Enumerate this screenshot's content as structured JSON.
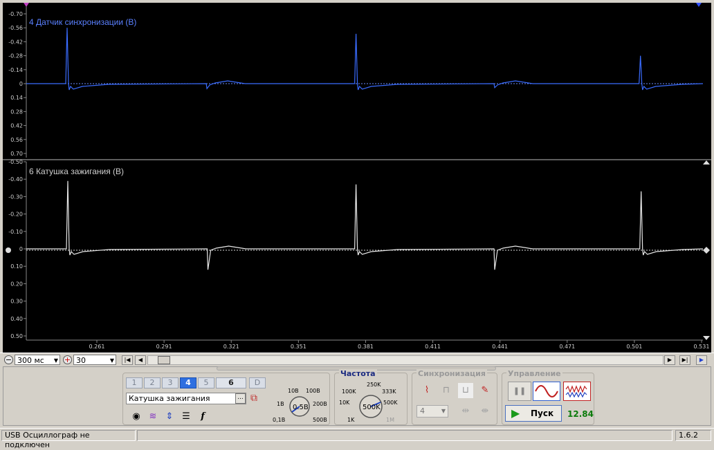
{
  "colors": {
    "bg": "#000000",
    "ch4": "#3a6cff",
    "ch6": "#e8e8e8",
    "green": "#0a7a0a"
  },
  "channel4": {
    "title": "4 Датчик синхронизации (В)",
    "ticks": [
      "-0.70",
      "-0.56",
      "-0.42",
      "-0.28",
      "-0.14",
      "0",
      "0.14",
      "0.28",
      "0.42",
      "0.56",
      "0.70"
    ]
  },
  "channel6": {
    "title": "6 Катушка зажигания (В)",
    "ticks": [
      "-0.50",
      "-0.40",
      "-0.30",
      "-0.20",
      "-0.10",
      "0",
      "0.10",
      "0.20",
      "0.30",
      "0.40",
      "0.50"
    ]
  },
  "time_ticks": [
    "0.261",
    "0.291",
    "0.321",
    "0.351",
    "0.381",
    "0.411",
    "0.441",
    "0.471",
    "0.501",
    "0.531"
  ],
  "chart_data": [
    {
      "type": "line",
      "title": "4 Датчик синхронизации (В)",
      "xlim": [
        0.2441,
        0.531
      ],
      "ylim": [
        0.7,
        -0.7
      ],
      "spikes": [
        {
          "t": 0.2614,
          "v": -0.56
        },
        {
          "t": 0.3207,
          "v": 0.05
        },
        {
          "t": 0.3839,
          "v": -0.5
        },
        {
          "t": 0.4427,
          "v": 0.04
        },
        {
          "t": 0.5045,
          "v": -0.28
        }
      ]
    },
    {
      "type": "line",
      "title": "6 Катушка зажигания (В)",
      "xlim": [
        0.2441,
        0.531
      ],
      "ylim": [
        0.5,
        -0.5
      ],
      "spikes": [
        {
          "t": 0.2617,
          "v": -0.39
        },
        {
          "t": 0.3211,
          "v": 0.12
        },
        {
          "t": 0.3839,
          "v": -0.37
        },
        {
          "t": 0.4427,
          "v": 0.12
        },
        {
          "t": 0.5048,
          "v": -0.33
        }
      ]
    }
  ],
  "toolbar": {
    "timebase": "300 мс",
    "zoom": "30"
  },
  "channels": {
    "buttons": [
      "1",
      "2",
      "3",
      "4",
      "5",
      "6",
      "D"
    ],
    "selected_name": "Катушка зажигания",
    "more": "..."
  },
  "volts": {
    "labels": [
      "10В",
      "100В",
      "1В",
      "200В",
      "0,1В",
      "500В"
    ],
    "value": "0.5В"
  },
  "freq": {
    "title": "Частота",
    "labels": [
      "250K",
      "100K",
      "333K",
      "10K",
      "500K",
      "1K",
      "1M"
    ],
    "value": "500K"
  },
  "sync": {
    "title": "Синхронизация",
    "channel": "4"
  },
  "control": {
    "title": "Управление",
    "start": "Пуск",
    "voltage": "12.84"
  },
  "status": {
    "text": "USB Осциллограф не подключен",
    "version": "1.6.2"
  }
}
